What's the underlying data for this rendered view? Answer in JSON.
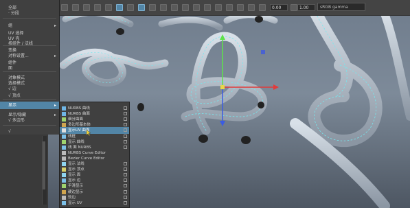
{
  "app": {
    "name": "Maya"
  },
  "toolbar": {
    "fields": [
      "0.00",
      "1.00"
    ],
    "space_label": "sRGB gamma"
  },
  "main_menu": {
    "items": [
      {
        "label": "全部",
        "arrow": "",
        "selected": false
      },
      {
        "label": "· 分段",
        "arrow": "",
        "selected": false
      },
      {
        "label": "组",
        "arrow": "▸",
        "selected": false
      },
      {
        "label": "UV 选择",
        "arrow": "",
        "selected": false
      },
      {
        "label": "UV 壳",
        "arrow": "",
        "selected": false
      },
      {
        "label": "按组件 / 法线",
        "arrow": "",
        "selected": false
      },
      {
        "label": "变换",
        "arrow": "",
        "selected": false
      },
      {
        "label": "对称设置...",
        "arrow": "▸",
        "selected": false
      },
      {
        "label": "组件",
        "arrow": "",
        "selected": false
      },
      {
        "label": "面",
        "arrow": "",
        "selected": false
      },
      {
        "label": "对象模式",
        "arrow": "",
        "selected": false
      },
      {
        "label": "选择模式",
        "arrow": "",
        "selected": false
      },
      {
        "label": "√ 边",
        "arrow": "",
        "selected": false
      },
      {
        "label": "√ 顶点",
        "arrow": "",
        "selected": false
      },
      {
        "label": "显示",
        "arrow": "▸",
        "selected": true
      },
      {
        "label": "显示/隐藏",
        "arrow": "▸",
        "selected": false
      },
      {
        "label": "√ 多边形",
        "arrow": "",
        "selected": false
      },
      {
        "label": "√",
        "arrow": "",
        "selected": false
      }
    ]
  },
  "submenu": {
    "items": [
      {
        "label": "NURBS 曲线",
        "box": true,
        "selected": false
      },
      {
        "label": "NURBS 曲面",
        "box": true,
        "selected": false
      },
      {
        "label": "细分曲面",
        "box": true,
        "selected": false
      },
      {
        "label": "多边形基本体",
        "box": true,
        "selected": false
      },
      {
        "label": "显示UV 曲面",
        "box": true,
        "selected": true
      },
      {
        "label": "线框",
        "box": true,
        "selected": false
      },
      {
        "label": "显示 曲线",
        "box": true,
        "selected": false
      },
      {
        "label": "线 面 NURBS",
        "box": true,
        "selected": false
      },
      {
        "label": "NURBS Curve Editor",
        "box": false,
        "selected": false
      },
      {
        "label": "Bezier Curve Editor",
        "box": false,
        "selected": false
      },
      {
        "label": "显示 法线",
        "box": true,
        "selected": false
      },
      {
        "label": "显示 顶点",
        "box": true,
        "selected": false
      },
      {
        "label": "显示 面",
        "box": true,
        "selected": false
      },
      {
        "label": "显示 边",
        "box": true,
        "selected": false
      },
      {
        "label": "平滑显示",
        "box": true,
        "selected": false
      },
      {
        "label": "硬边显示",
        "box": true,
        "selected": false
      },
      {
        "label": "软边",
        "box": true,
        "selected": false
      },
      {
        "label": "显示 UV",
        "box": true,
        "selected": false
      }
    ]
  },
  "colors": {
    "accent": "#5285a6",
    "menu_bg": "#404040",
    "wire": "#76e7ee",
    "rope": "#b9c2cc"
  }
}
